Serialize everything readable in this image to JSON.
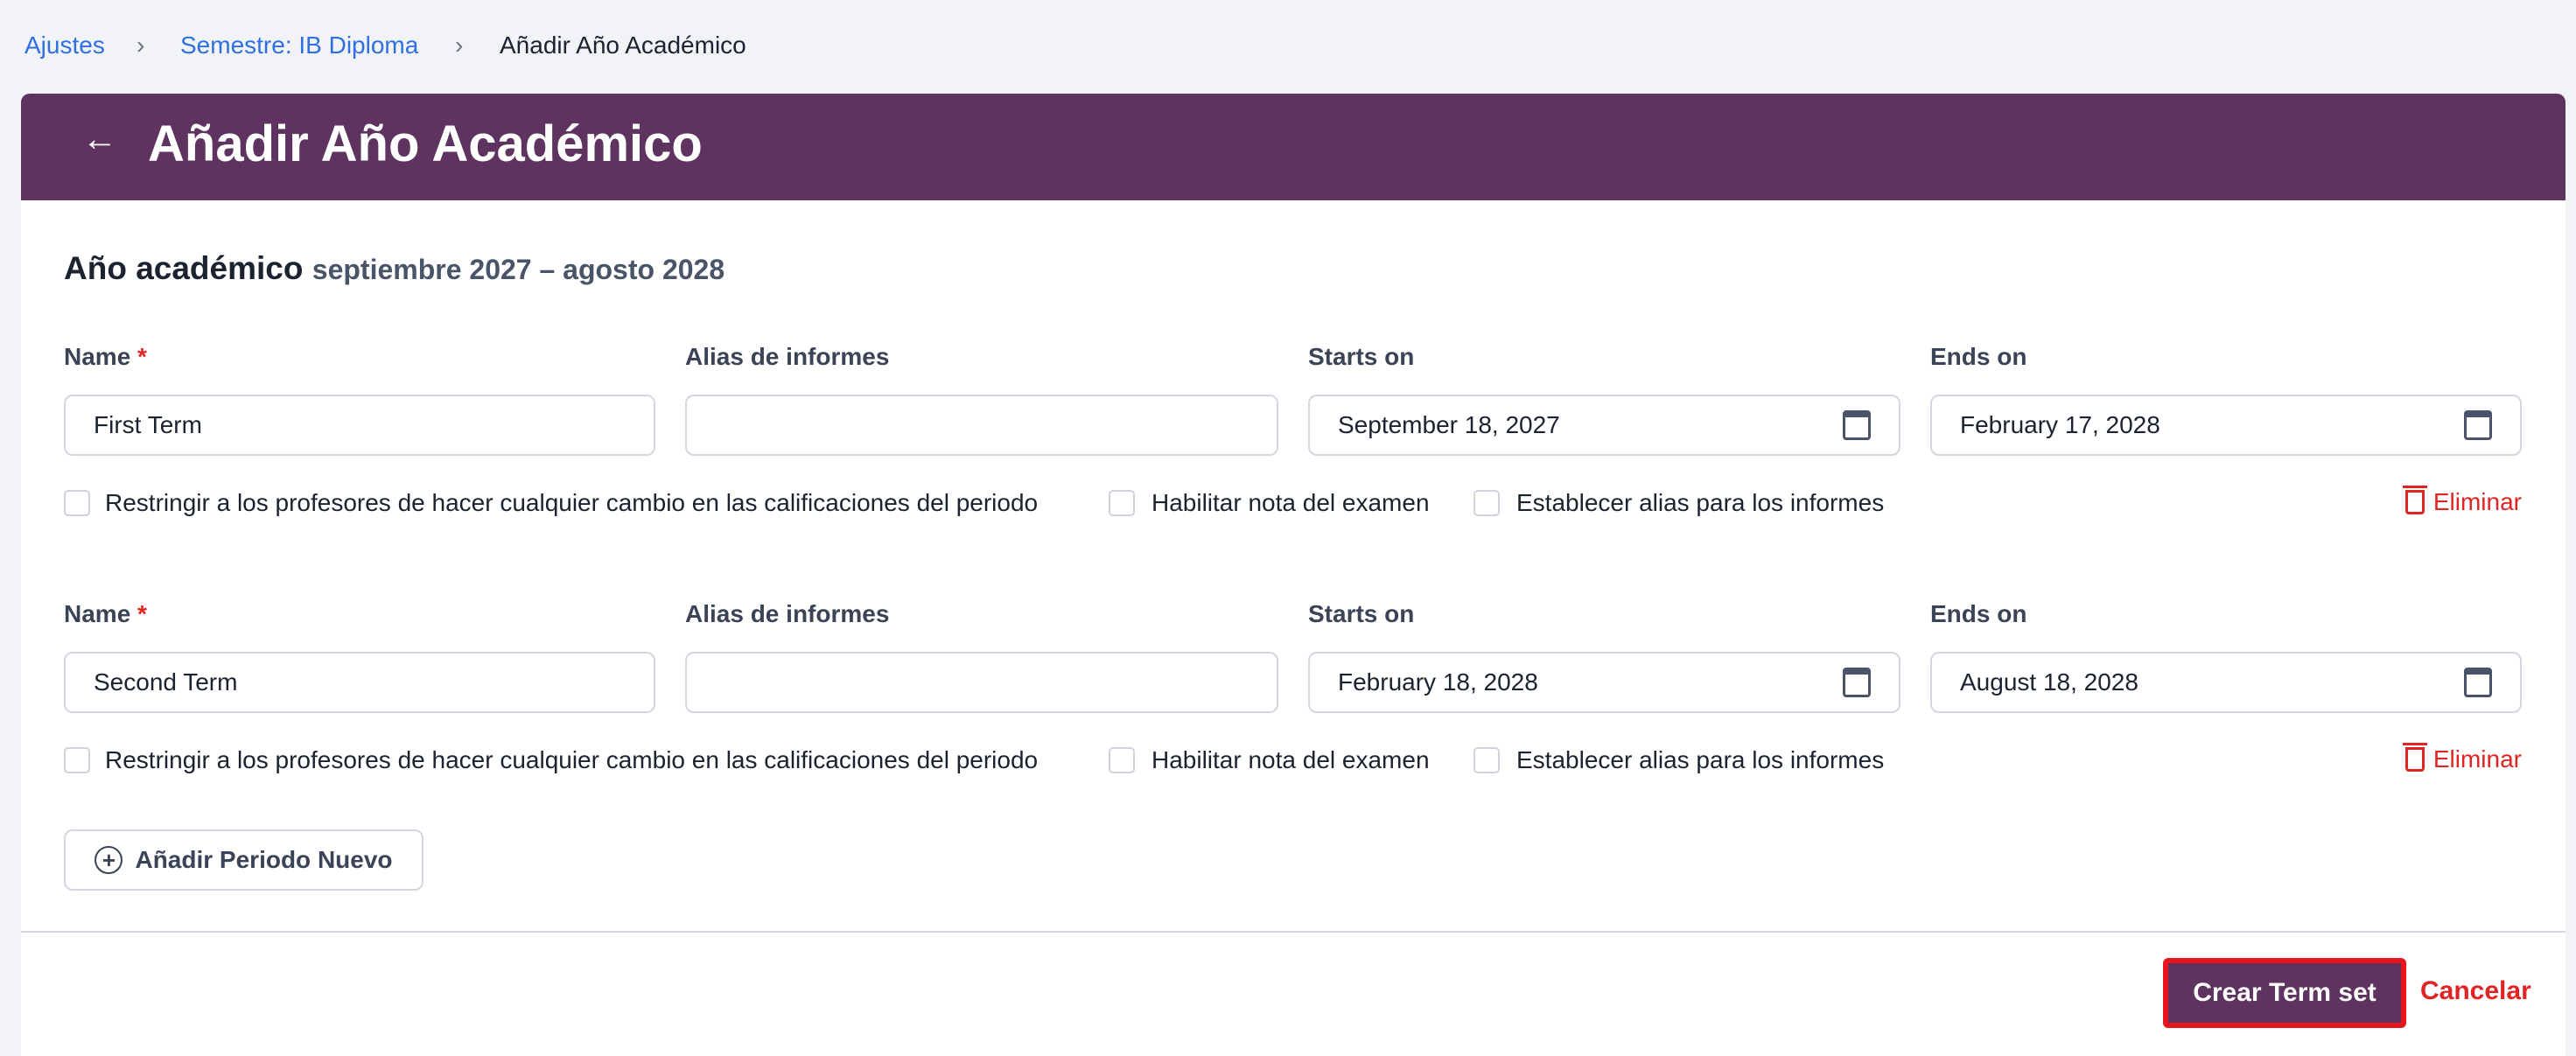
{
  "breadcrumb": {
    "items": [
      "Ajustes",
      "Semestre: IB Diploma",
      "Añadir Año Académico"
    ]
  },
  "header": {
    "title": "Añadir Año Académico",
    "back_icon": "arrow-left-icon"
  },
  "section": {
    "title": "Año académico",
    "range": "septiembre 2027 – agosto 2028"
  },
  "labels": {
    "name": "Name",
    "required": "*",
    "alias": "Alias de informes",
    "starts": "Starts on",
    "ends": "Ends on"
  },
  "checkbox_labels": {
    "restrict": "Restringir a los profesores de hacer cualquier cambio en las calificaciones del periodo",
    "exam": "Habilitar nota del examen",
    "alias": "Establecer alias para los informes"
  },
  "terms": [
    {
      "name": "First Term",
      "alias": "",
      "starts": "September 18, 2027",
      "ends": "February 17, 2028",
      "delete": "Eliminar"
    },
    {
      "name": "Second Term",
      "alias": "",
      "starts": "February 18, 2028",
      "ends": "August 18, 2028",
      "delete": "Eliminar"
    }
  ],
  "actions": {
    "add": "Añadir Periodo Nuevo",
    "create": "Crear Term set",
    "cancel": "Cancelar"
  },
  "colors": {
    "brand": "#5e3360",
    "danger": "#e02424",
    "link": "#2f6fe0"
  }
}
